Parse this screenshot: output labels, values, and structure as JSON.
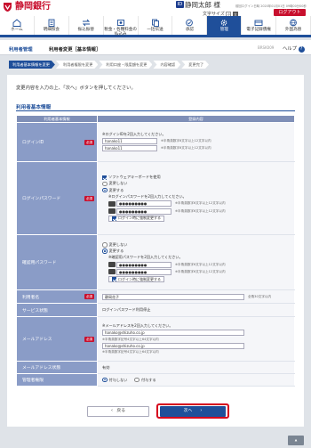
{
  "header": {
    "bank_name": "静岡銀行",
    "user_name": "静岡太郎 様",
    "user_icon": "user-icon",
    "last_login": "前回ログイン日時 2020年01月01日 09時00分00秒",
    "font_size_label": "文字サイズ",
    "font_small": "小",
    "font_large": "大",
    "logout_label": "ログアウト",
    "accent_color": "#c8102e",
    "brand_color": "#1f4f9a"
  },
  "nav": {
    "items": [
      {
        "label": "ホーム",
        "icon": "home-icon"
      },
      {
        "label": "明細照会",
        "icon": "statement-icon"
      },
      {
        "label": "振込振替",
        "icon": "transfer-icon"
      },
      {
        "label": "税金・各種料金の払込み",
        "icon": "tax-payment-icon"
      },
      {
        "label": "一括伝送",
        "icon": "bulk-transmission-icon"
      },
      {
        "label": "承認",
        "icon": "approval-icon"
      },
      {
        "label": "管理",
        "icon": "gear-icon"
      },
      {
        "label": "電子記録債権",
        "icon": "electronic-claim-icon"
      },
      {
        "label": "外国為替",
        "icon": "forex-icon"
      }
    ],
    "active_index": 6
  },
  "title_bar": {
    "breadcrumb": "利用者管理",
    "page_title": "利用者変更［基本情報］",
    "screen_id": "BRSK009",
    "help_label": "ヘルプ",
    "help_icon": "?"
  },
  "steps": [
    "利用者基本情報を変更",
    "利用者権限を変更",
    "利用口座・限度額を変更",
    "内容確認",
    "変更完了"
  ],
  "guide_text": "変更内容を入力の上、「次へ」ボタンを押してください。",
  "section_title": "利用者基本情報",
  "table": {
    "col_item": "利用者基本情報",
    "col_content": "登録内容",
    "required_label": "必須",
    "login_id": {
      "label": "ログインID",
      "note": "※ログインIDを2回入力してください。",
      "value1": "hanako11",
      "value2": "hanako11",
      "hint": "※半角英数字6文字以上12文字以内"
    },
    "login_password": {
      "label": "ログインパスワード",
      "keyboard_label": "ソフトウェアキーボードを使用",
      "option_no": "変更しない",
      "option_yes": "変更する",
      "note": "※ログインパスワードを2回入力してください。",
      "masked": "●●●●●●●●●",
      "hint": "※半角英数字6文字以上12文字以内",
      "force_change": "ログイン時に強制変更する"
    },
    "confirm_password": {
      "label": "確認用パスワード",
      "option_no": "変更しない",
      "option_yes": "変更する",
      "note": "※確認用パスワードを2回入力してください。",
      "masked": "●●●●●●●●●",
      "hint": "※半角英数字6文字以上12文字以内",
      "force_change": "ログイン時に強制変更する"
    },
    "user_name": {
      "label": "利用者名",
      "value": "静岡花子",
      "hint": "全角30文字以内"
    },
    "service_status": {
      "label": "サービス状態",
      "value": "ログインパスワード利用停止"
    },
    "email": {
      "label": "メールアドレス",
      "note": "※メールアドレスを2回入力してください。",
      "value1": "hanako@shizuho.co.jp",
      "value2": "hanako@shizuho.co.jp",
      "hint": "※半角英数字記号4文字以上64文字以内"
    },
    "email_status": {
      "label": "メールアドレス状態",
      "value": "有効"
    },
    "admin_privilege": {
      "label": "管理者権限",
      "option_no": "付与しない",
      "option_yes": "付与する"
    }
  },
  "buttons": {
    "back": "戻る",
    "next": "次へ"
  },
  "footer": {
    "page_top": "ページトップ"
  }
}
